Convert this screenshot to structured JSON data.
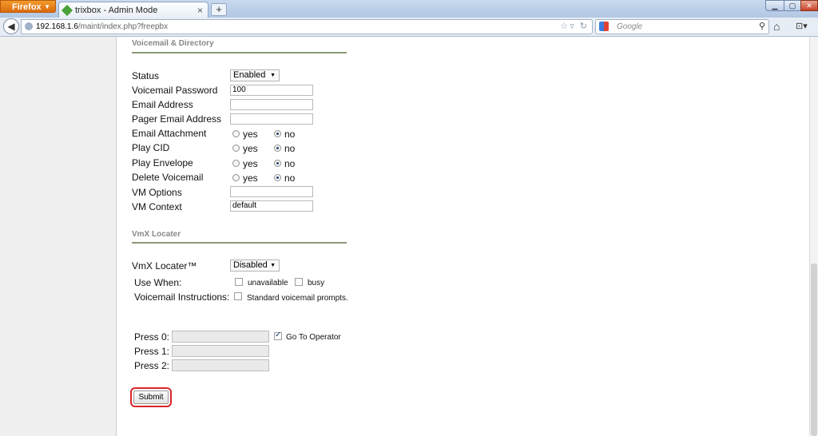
{
  "browser": {
    "menu_label": "Firefox",
    "tab_title": "trixbox - Admin Mode",
    "url_host": "192.168.1.6",
    "url_path": "/maint/index.php?freepbx",
    "search_placeholder": "Google"
  },
  "voicemail": {
    "heading": "Voicemail & Directory",
    "status_label": "Status",
    "status_value": "Enabled",
    "password_label": "Voicemail Password",
    "password_value": "100",
    "email_label": "Email Address",
    "email_value": "",
    "pager_label": "Pager Email Address",
    "pager_value": "",
    "attach_label": "Email Attachment",
    "playcid_label": "Play CID",
    "envelope_label": "Play Envelope",
    "delete_label": "Delete Voicemail",
    "vmoptions_label": "VM Options",
    "vmoptions_value": "",
    "vmcontext_label": "VM Context",
    "vmcontext_value": "default",
    "yes": "yes",
    "no": "no"
  },
  "vmx": {
    "heading": "VmX Locater",
    "locater_label": "VmX Locater™",
    "locater_value": "Disabled",
    "usewhen_label": "Use When:",
    "unavailable_label": "unavailable",
    "busy_label": "busy",
    "instructions_label": "Voicemail Instructions:",
    "standard_label": "Standard voicemail prompts.",
    "press0_label": "Press 0:",
    "press1_label": "Press 1:",
    "press2_label": "Press 2:",
    "operator_label": "Go To Operator",
    "unavailable_checked": false,
    "busy_checked": false,
    "standard_checked": false,
    "operator_checked": true
  },
  "form": {
    "submit_label": "Submit"
  }
}
